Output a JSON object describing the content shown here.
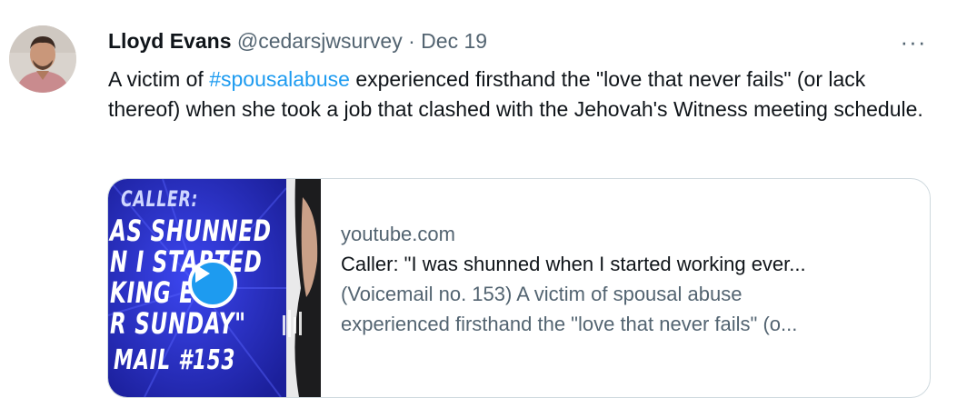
{
  "tweet": {
    "author_name": "Lloyd Evans",
    "author_handle": "@cedarsjwsurvey",
    "separator": "·",
    "date": "Dec 19",
    "more_label": "···",
    "text_before": "A victim of ",
    "hashtag": "#spousalabuse",
    "text_after": " experienced firsthand the \"love that never fails\" (or lack thereof) when she took a job that clashed with the Jehovah's Witness meeting schedule."
  },
  "card": {
    "domain": "youtube.com",
    "title": "Caller: \"I was shunned when I started working ever...",
    "description_line1": "(Voicemail no. 153) A victim of spousal abuse",
    "description_line2": "experienced firsthand the \"love that never fails\" (o...",
    "thumbnail": {
      "line1": "CALLER:",
      "line2": "AS SHUNNED",
      "line3": "N I STARTED",
      "line4": "KING EV",
      "line5": "R SUNDAY\"",
      "line6": "MAIL #153",
      "play_icon": "play-icon"
    }
  },
  "colors": {
    "link": "#1d9bf0",
    "secondary_text": "#536471",
    "primary_text": "#0f1419",
    "thumbnail_bg": "#2a2fd6"
  }
}
